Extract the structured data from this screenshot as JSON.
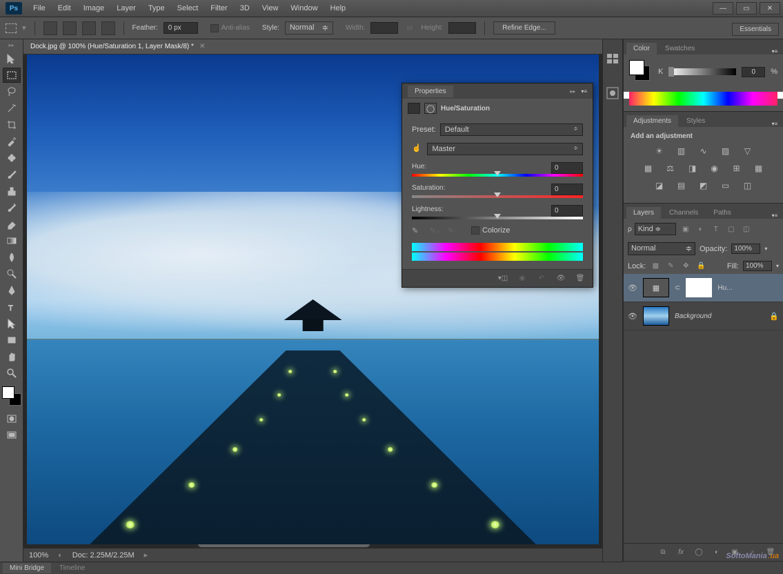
{
  "menu": {
    "items": [
      "File",
      "Edit",
      "Image",
      "Layer",
      "Type",
      "Select",
      "Filter",
      "3D",
      "View",
      "Window",
      "Help"
    ]
  },
  "options": {
    "feather_label": "Feather:",
    "feather_val": "0 px",
    "antialias": "Anti-alias",
    "style_label": "Style:",
    "style_val": "Normal",
    "width_label": "Width:",
    "height_label": "Height:",
    "refine": "Refine Edge...",
    "essentials": "Essentials"
  },
  "doc": {
    "title": "Dock.jpg @ 100% (Hue/Saturation 1, Layer Mask/8) *",
    "zoom": "100%",
    "stat": "Doc: 2.25M/2.25M"
  },
  "bottom": {
    "tabs": [
      "Mini Bridge",
      "Timeline"
    ]
  },
  "color": {
    "tab1": "Color",
    "tab2": "Swatches",
    "channel": "K",
    "value": "0",
    "pct": "%"
  },
  "adjustments": {
    "tab1": "Adjustments",
    "tab2": "Styles",
    "title": "Add an adjustment"
  },
  "layers": {
    "tab1": "Layers",
    "tab2": "Channels",
    "tab3": "Paths",
    "kind_label": "Kind",
    "kind_arrow": "≑",
    "blend": "Normal",
    "opacity_label": "Opacity:",
    "opacity": "100%",
    "lock_label": "Lock:",
    "fill_label": "Fill:",
    "fill": "100%",
    "layer1": "Hu...",
    "layer2": "Background"
  },
  "props": {
    "tab": "Properties",
    "title": "Hue/Saturation",
    "preset_label": "Preset:",
    "preset": "Default",
    "channel": "Master",
    "hue_label": "Hue:",
    "hue": "0",
    "sat_label": "Saturation:",
    "sat": "0",
    "lig_label": "Lightness:",
    "lig": "0",
    "colorize": "Colorize"
  },
  "watermark": "SoftoMania"
}
